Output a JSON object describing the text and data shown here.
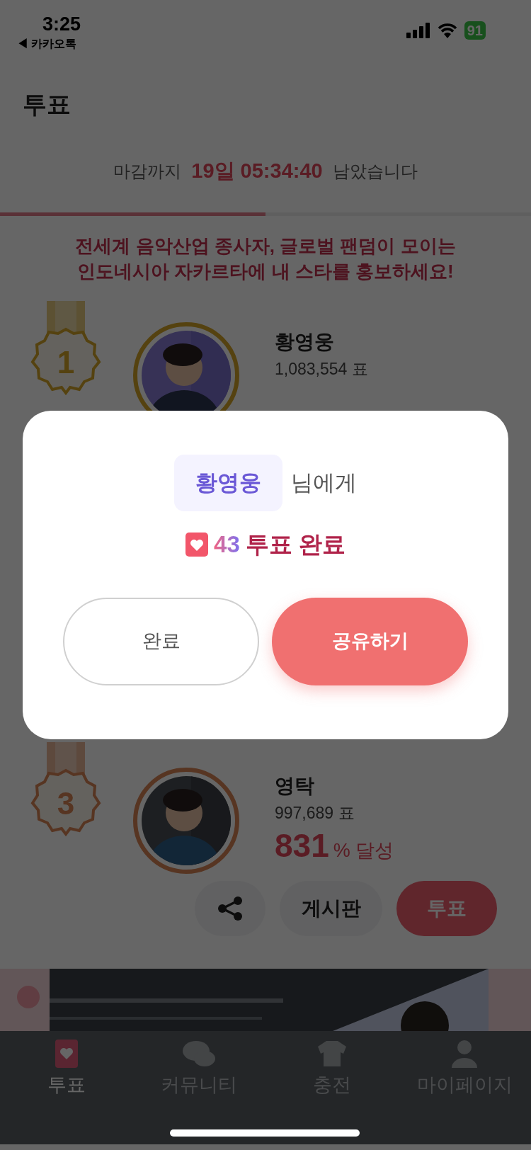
{
  "status_bar": {
    "time": "3:25",
    "back_label": "◀ 카카오톡",
    "battery": "91"
  },
  "header": {
    "title": "투표"
  },
  "countdown": {
    "prefix": "마감까지",
    "value": "19일 05:34:40",
    "suffix": "남았습니다",
    "level": 0.5
  },
  "banner_text": "전세계 음악산업 종사자, 글로벌 팬덤이 모이는\n인도네시아 자카르타에 내 스타를 홍보하세요!",
  "rankings": [
    {
      "kind": "gold",
      "rank": "1",
      "name": "황영웅",
      "votes": "1,083,554 표"
    },
    {
      "kind": "bronze",
      "rank": "3",
      "name": "영탁",
      "votes": "997,689 표",
      "percent": "831",
      "percent_unit": "% 달성",
      "board_label": "게시판",
      "vote_label": "투표"
    }
  ],
  "modal": {
    "recipient": "황영웅",
    "recipient_suffix": "님에게",
    "count": "43",
    "result": "투표 완료",
    "buttons": [
      {
        "label": "완료",
        "kind": "secondary"
      },
      {
        "label": "공유하기",
        "kind": "primary"
      }
    ]
  },
  "nav": [
    {
      "label": "투표",
      "selected": true
    },
    {
      "label": "커뮤니티",
      "selected": false
    },
    {
      "label": "충전",
      "selected": false
    },
    {
      "label": "마이페이지",
      "selected": false
    }
  ]
}
